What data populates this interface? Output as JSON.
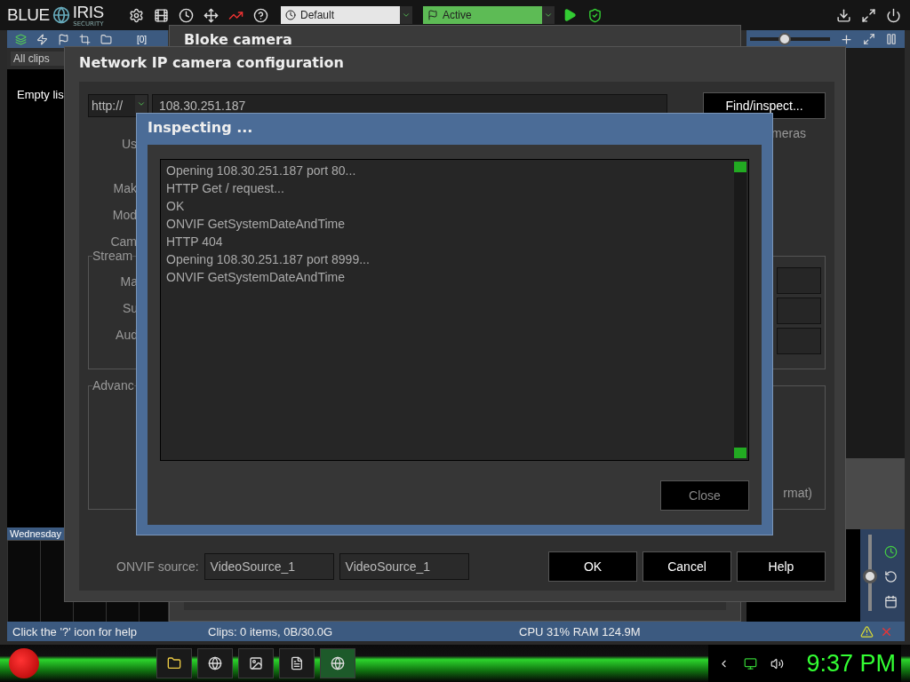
{
  "app": {
    "logo": [
      "BLUE",
      "IRIS"
    ],
    "logo_tag": "SECURITY",
    "profile": "Default",
    "schedule": "Active"
  },
  "clips_panel": {
    "counter": "[0]",
    "filter": "All clips",
    "empty_text": "Empty lis",
    "day": "Wednesday"
  },
  "camera_panel": {
    "zoom": {
      "level": 0.42
    },
    "speed": {
      "level": 0.45
    }
  },
  "camera_window": {
    "title": "Bloke camera"
  },
  "config_dialog": {
    "title": "Network IP camera configuration",
    "protocol": "http://",
    "address": "108.30.251.187",
    "find_button": "Find/inspect...",
    "labels": [
      "Us",
      "Mak",
      "Mod",
      "Cam"
    ],
    "right_label": "meras",
    "streams_group": {
      "title": "Stream",
      "labels": [
        "Ma",
        "Su",
        "Aud"
      ]
    },
    "advanced_group": {
      "title": "Advanc",
      "note": "rmat)"
    },
    "onvif_label": "ONVIF source:",
    "onvif_values": [
      "VideoSource_1",
      "VideoSource_1"
    ],
    "buttons": [
      "OK",
      "Cancel",
      "Help"
    ]
  },
  "inspect_dialog": {
    "title": "Inspecting ...",
    "log": [
      "Opening 108.30.251.187 port 80...",
      "HTTP Get / request...",
      "OK",
      "ONVIF GetSystemDateAndTime",
      "HTTP 404",
      "Opening 108.30.251.187 port 8999...",
      "ONVIF GetSystemDateAndTime"
    ],
    "close_button": "Close"
  },
  "status_bar": [
    "Click the '?' icon for help",
    "Clips: 0 items, 0B/30.0G",
    "CPU 31% RAM 124.9M"
  ],
  "taskbar": {
    "clock": "9:37 PM"
  }
}
